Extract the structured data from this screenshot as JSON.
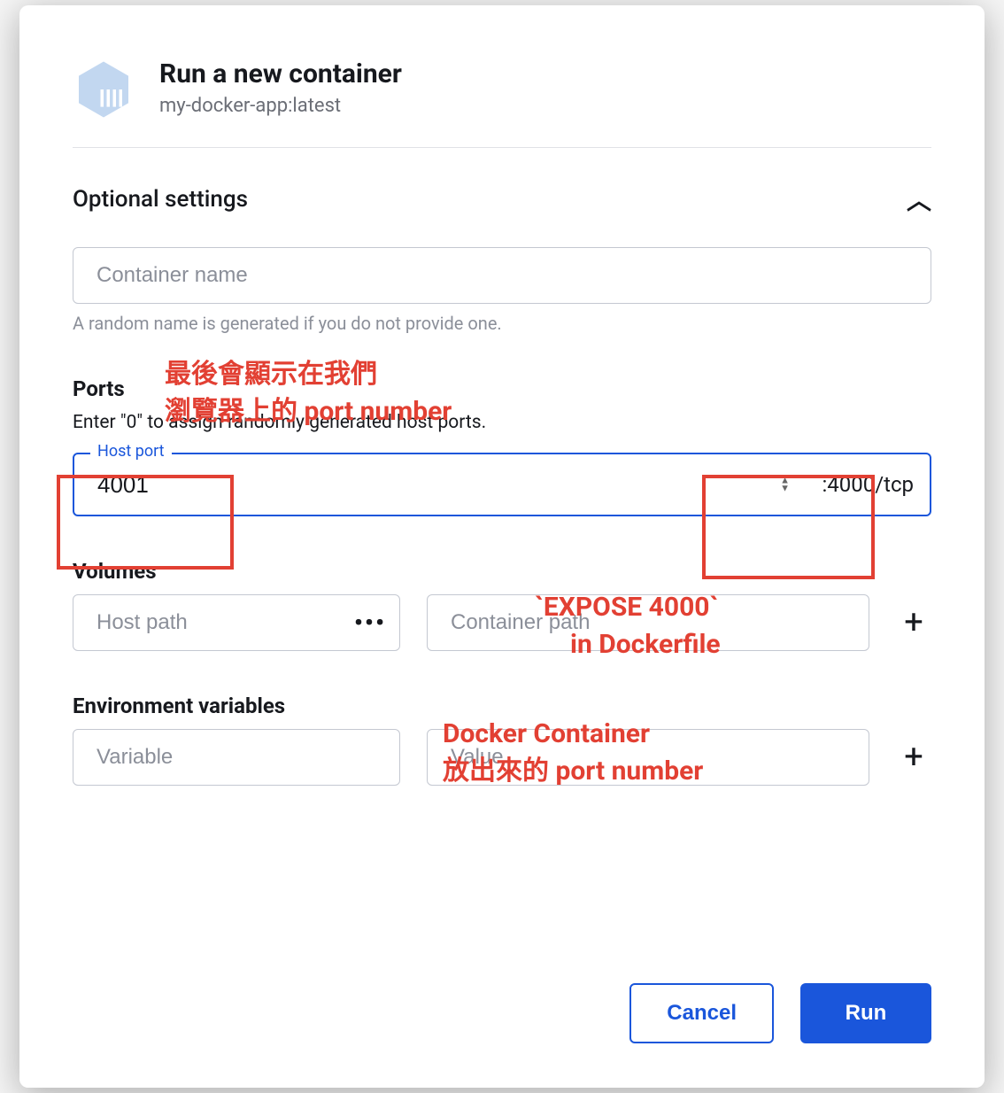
{
  "header": {
    "title": "Run a new container",
    "image_tag": "my-docker-app:latest"
  },
  "optional_settings": {
    "label": "Optional settings",
    "container_name_placeholder": "Container name",
    "container_name_helper": "A random name is generated if you do not provide one."
  },
  "ports": {
    "label": "Ports",
    "description": "Enter \"0\" to assign randomly generated host ports.",
    "host_port_label": "Host port",
    "host_port_value": "4001",
    "container_port_suffix": ":4000/tcp"
  },
  "volumes": {
    "label": "Volumes",
    "host_path_placeholder": "Host path",
    "container_path_placeholder": "Container path"
  },
  "env": {
    "label": "Environment variables",
    "variable_placeholder": "Variable",
    "value_placeholder": "Value"
  },
  "footer": {
    "cancel": "Cancel",
    "run": "Run"
  },
  "annotations": {
    "a1_line1": "最後會顯示在我們",
    "a1_line2": "瀏覽器上的 port number",
    "a2_line1": "`EXPOSE 4000`",
    "a2_line2": "in Dockerfile",
    "a3_line1": "Docker Container",
    "a3_line2": "放出來的 port number"
  }
}
